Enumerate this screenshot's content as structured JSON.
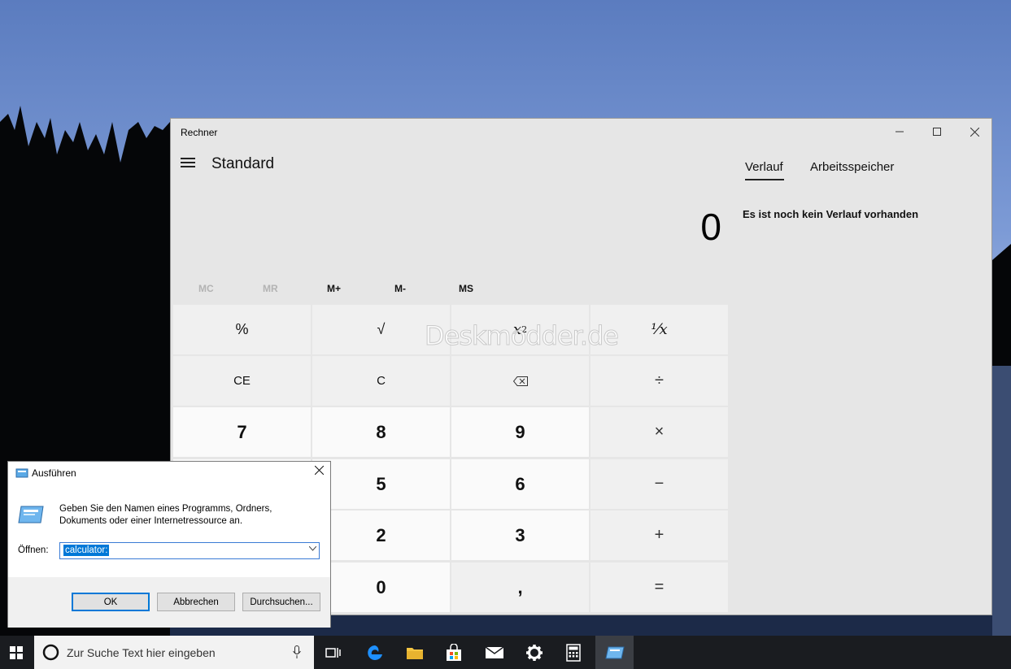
{
  "calculator": {
    "window_title": "Rechner",
    "mode": "Standard",
    "display_value": "0",
    "memory_buttons": [
      "MC",
      "MR",
      "M+",
      "M-",
      "MS"
    ],
    "keys": {
      "percent": "%",
      "sqrt": "√",
      "square_base": "x",
      "square_exp": "2",
      "reciprocal": "¹⁄x",
      "ce": "CE",
      "c": "C",
      "backspace": "⌫",
      "divide": "÷",
      "seven": "7",
      "eight": "8",
      "nine": "9",
      "multiply": "×",
      "five": "5",
      "six": "6",
      "minus": "−",
      "two": "2",
      "three": "3",
      "plus": "+",
      "zero": "0",
      "comma": ",",
      "equals": "="
    },
    "tabs": [
      "Verlauf",
      "Arbeitsspeicher"
    ],
    "history_empty": "Es ist noch kein Verlauf vorhanden",
    "watermark": "Deskmodder.de"
  },
  "run_dialog": {
    "title": "Ausführen",
    "description_line1": "Geben Sie den Namen eines Programms, Ordners,",
    "description_line2": "Dokuments oder einer Internetressource an.",
    "open_label": "Öffnen:",
    "input_value": "calculator:",
    "ok_label": "OK",
    "cancel_label": "Abbrechen",
    "browse_label": "Durchsuchen..."
  },
  "taskbar": {
    "search_placeholder": "Zur Suche Text hier eingeben",
    "icons": [
      "windows-start",
      "cortana",
      "microphone",
      "task-view",
      "edge",
      "file-explorer",
      "store",
      "mail",
      "settings",
      "calculator",
      "run"
    ]
  },
  "colors": {
    "accent": "#0078d7",
    "taskbar": "#1a1c20",
    "calculator_bg": "#e6e6e6"
  }
}
